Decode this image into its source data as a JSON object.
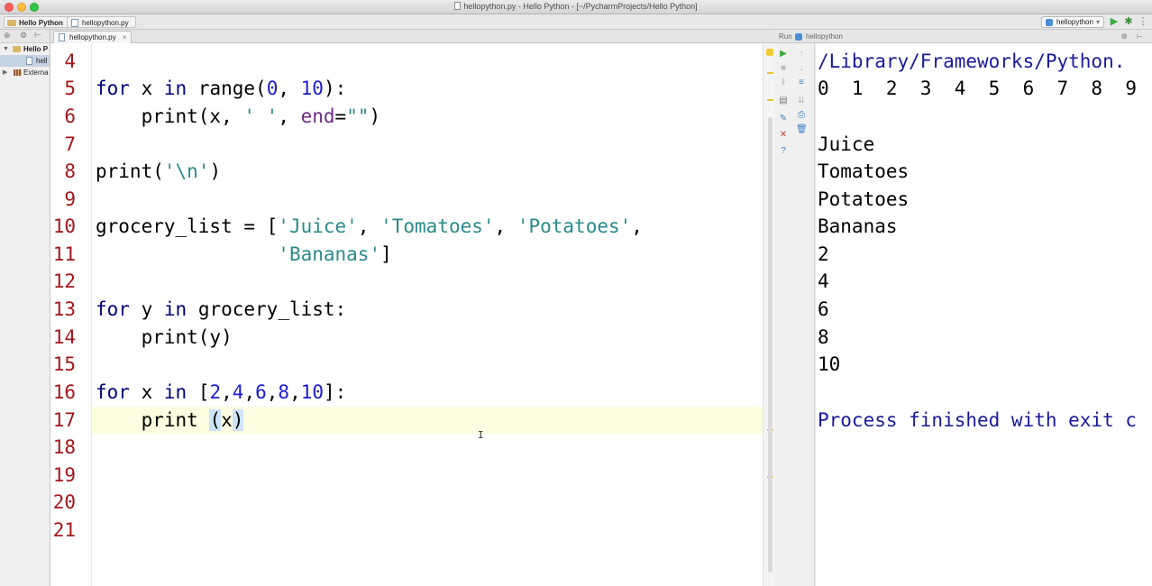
{
  "window": {
    "title": "hellopython.py - Hello Python - [~/PycharmProjects/Hello Python]"
  },
  "navbar": {
    "crumbs": [
      "Hello Python",
      "hellopython.py"
    ],
    "run_config": "hellopython"
  },
  "project_tree": {
    "items": [
      {
        "label": "Hello P",
        "kind": "folder"
      },
      {
        "label": "hell",
        "kind": "file"
      },
      {
        "label": "Externa",
        "kind": "library"
      }
    ]
  },
  "editor": {
    "tab_label": "hellopython.py",
    "line_numbers": [
      "4",
      "5",
      "6",
      "7",
      "8",
      "9",
      "10",
      "11",
      "12",
      "13",
      "14",
      "15",
      "16",
      "17",
      "18",
      "19",
      "20",
      "21"
    ],
    "current_line_index": 13
  },
  "run_panel": {
    "header_label": "Run",
    "config_name": "hellopython",
    "console_lines": [
      "/Library/Frameworks/Python.",
      "0  1  2  3  4  5  6  7  8  9",
      "",
      "Juice",
      "Tomatoes",
      "Potatoes",
      "Bananas",
      "2",
      "4",
      "6",
      "8",
      "10",
      "",
      "Process finished with exit c"
    ]
  },
  "colors": {
    "line_number": "#a3171a",
    "keyword": "#00007f",
    "string": "#2a8b8b",
    "number": "#1b1bd0",
    "keyword_arg": "#6f2a86",
    "current_line_bg": "#fdfde1"
  }
}
